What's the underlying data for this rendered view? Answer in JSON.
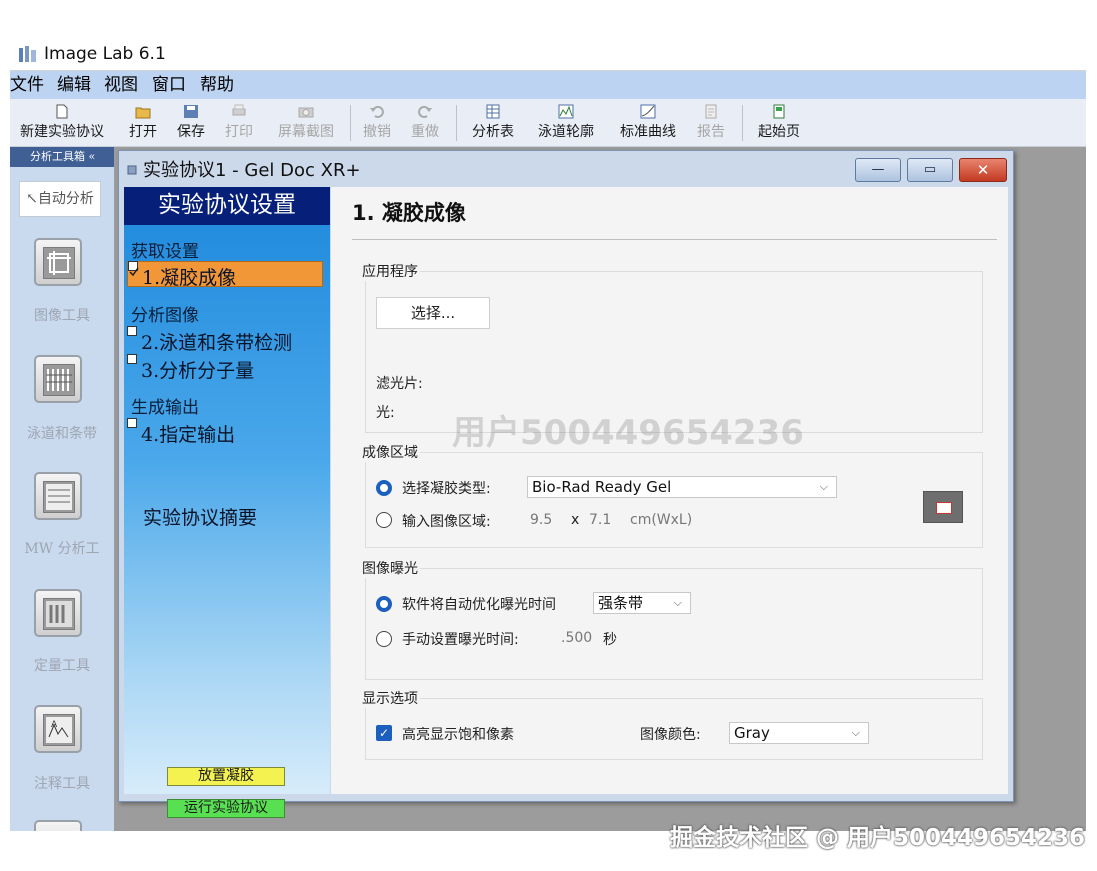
{
  "app": {
    "title": "Image Lab 6.1"
  },
  "menu": [
    "文件",
    "编辑",
    "视图",
    "窗口",
    "帮助"
  ],
  "toolbar": [
    {
      "label": "新建实验协议",
      "icon": "new-document-icon",
      "enabled": true
    },
    {
      "label": "打开",
      "icon": "open-folder-icon",
      "enabled": true
    },
    {
      "label": "保存",
      "icon": "save-disk-icon",
      "enabled": true
    },
    {
      "label": "打印",
      "icon": "printer-icon",
      "enabled": false
    },
    {
      "label": "屏幕截图",
      "icon": "camera-icon",
      "enabled": false
    },
    {
      "label": "撤销",
      "icon": "undo-icon",
      "enabled": false
    },
    {
      "label": "重做",
      "icon": "redo-icon",
      "enabled": false
    },
    {
      "label": "分析表",
      "icon": "table-icon",
      "enabled": true
    },
    {
      "label": "泳道轮廓",
      "icon": "lane-profile-icon",
      "enabled": true
    },
    {
      "label": "标准曲线",
      "icon": "standard-curve-icon",
      "enabled": true
    },
    {
      "label": "报告",
      "icon": "report-icon",
      "enabled": false
    },
    {
      "label": "起始页",
      "icon": "start-page-icon",
      "enabled": true
    }
  ],
  "toolbox": {
    "header": "分析工具箱 «",
    "auto_button": "↖自动分析",
    "tools": [
      "图像工具",
      "泳道和条带",
      "MW 分析工",
      "定量工具",
      "注释工具"
    ]
  },
  "dialog": {
    "title": "实验协议1 - Gel Doc XR+",
    "controls": {
      "minimize": "—",
      "maximize": "▭",
      "close": "✕"
    }
  },
  "protocol": {
    "header": "实验协议设置",
    "sections": {
      "acquire": "获取设置",
      "analyze": "分析图像",
      "output": "生成输出"
    },
    "steps": [
      {
        "label": "1.凝胶成像",
        "checked": true
      },
      {
        "label": "2.泳道和条带检测",
        "checked": false
      },
      {
        "label": "3.分析分子量",
        "checked": false
      },
      {
        "label": "4.指定输出",
        "checked": false
      }
    ],
    "summary": "实验协议摘要",
    "place_gel": "放置凝胶",
    "run_protocol": "运行实验协议"
  },
  "content": {
    "title": "1. 凝胶成像",
    "application": {
      "group": "应用程序",
      "select_button": "选择...",
      "filter_label": "滤光片:",
      "light_label": "光:"
    },
    "imaging_area": {
      "group": "成像区域",
      "radio_gel_type": "选择凝胶类型:",
      "gel_type_value": "Bio-Rad Ready Gel",
      "radio_input_area": "输入图像区域:",
      "width": "9.5",
      "times": "x",
      "length": "7.1",
      "unit": "cm(WxL)",
      "selected": "gel_type"
    },
    "exposure": {
      "group": "图像曝光",
      "radio_auto": "软件将自动优化曝光时间",
      "auto_value": "强条带",
      "radio_manual": "手动设置曝光时间:",
      "manual_value": ".500",
      "manual_unit": "秒",
      "selected": "auto"
    },
    "display": {
      "group": "显示选项",
      "highlight_label": "高亮显示饱和像素",
      "highlight_checked": true,
      "color_label": "图像颜色:",
      "color_value": "Gray"
    }
  },
  "watermarks": {
    "center": "用户500449654236",
    "bottom": "掘金技术社区 @ 用户500449654236"
  },
  "colors": {
    "menubar": "#bcd3f1",
    "protocol_header": "#06207a",
    "active_step": "#f29737",
    "radio_checked": "#1c5fbf"
  }
}
